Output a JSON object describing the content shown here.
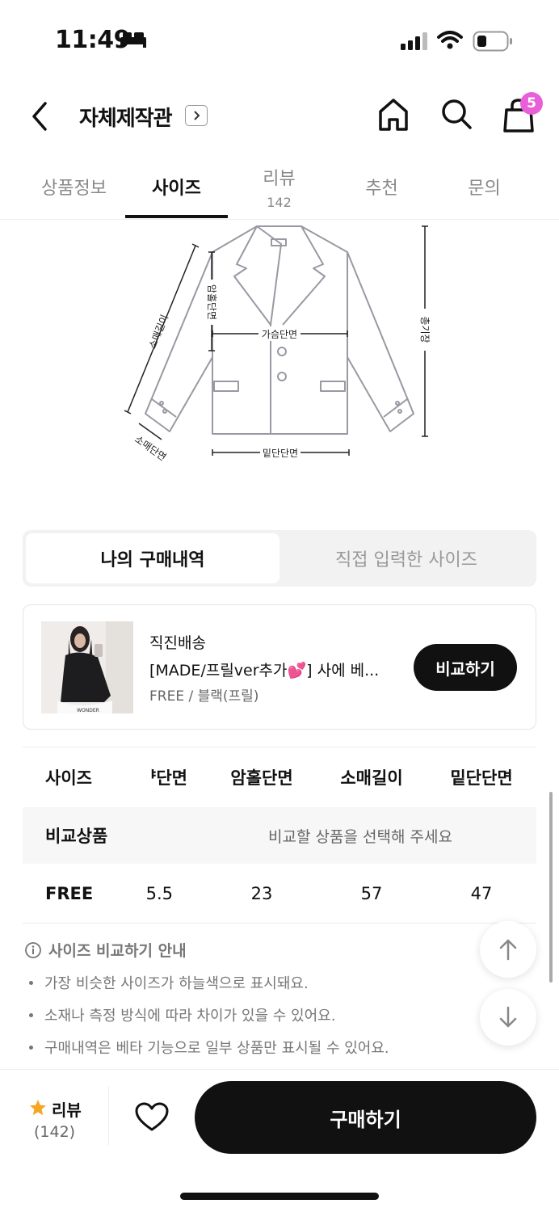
{
  "status": {
    "time": "11:49"
  },
  "header": {
    "title": "자체제작관",
    "cart_count": "5"
  },
  "tabs": [
    {
      "label": "상품정보"
    },
    {
      "label": "사이즈"
    },
    {
      "label": "리뷰",
      "count": "142"
    },
    {
      "label": "추천"
    },
    {
      "label": "문의"
    }
  ],
  "diagram": {
    "labels": {
      "sleeve_length": "소매길이",
      "armhole": "암홀단면",
      "chest": "가슴단면",
      "total_length": "총기장",
      "sleeve_width": "소매단면",
      "hem": "밑단단면"
    }
  },
  "segment": {
    "active": "나의 구매내역",
    "inactive": "직접 입력한 사이즈"
  },
  "product": {
    "shipping": "직진배송",
    "name": "[MADE/프릴ver추가💕] 사에 베...",
    "option": "FREE / 블랙(프릴)",
    "compare_label": "비교하기",
    "thumb_text": "WONDER"
  },
  "table": {
    "headers": [
      "사이즈",
      "ᅣ단면",
      "암홀단면",
      "소매길이",
      "밑단단면"
    ],
    "compare_row": {
      "label": "비교상품",
      "message": "비교할 상품을 선택해 주세요"
    },
    "free_row": [
      "FREE",
      "5.5",
      "23",
      "57",
      "47"
    ]
  },
  "guide": {
    "title": "사이즈 비교하기 안내",
    "items": [
      "가장 비슷한 사이즈가 하늘색으로 표시돼요.",
      "소재나 측정 방식에 따라 차이가 있을 수 있어요.",
      "구매내역은 베타 기능으로 일부 상품만 표시될 수 있어요."
    ]
  },
  "bottom": {
    "review_label": "리뷰",
    "review_count": "(142)",
    "buy_label": "구매하기"
  },
  "colors": {
    "badge": "#e85fd9",
    "star": "#f5a623",
    "primary": "#111111"
  }
}
